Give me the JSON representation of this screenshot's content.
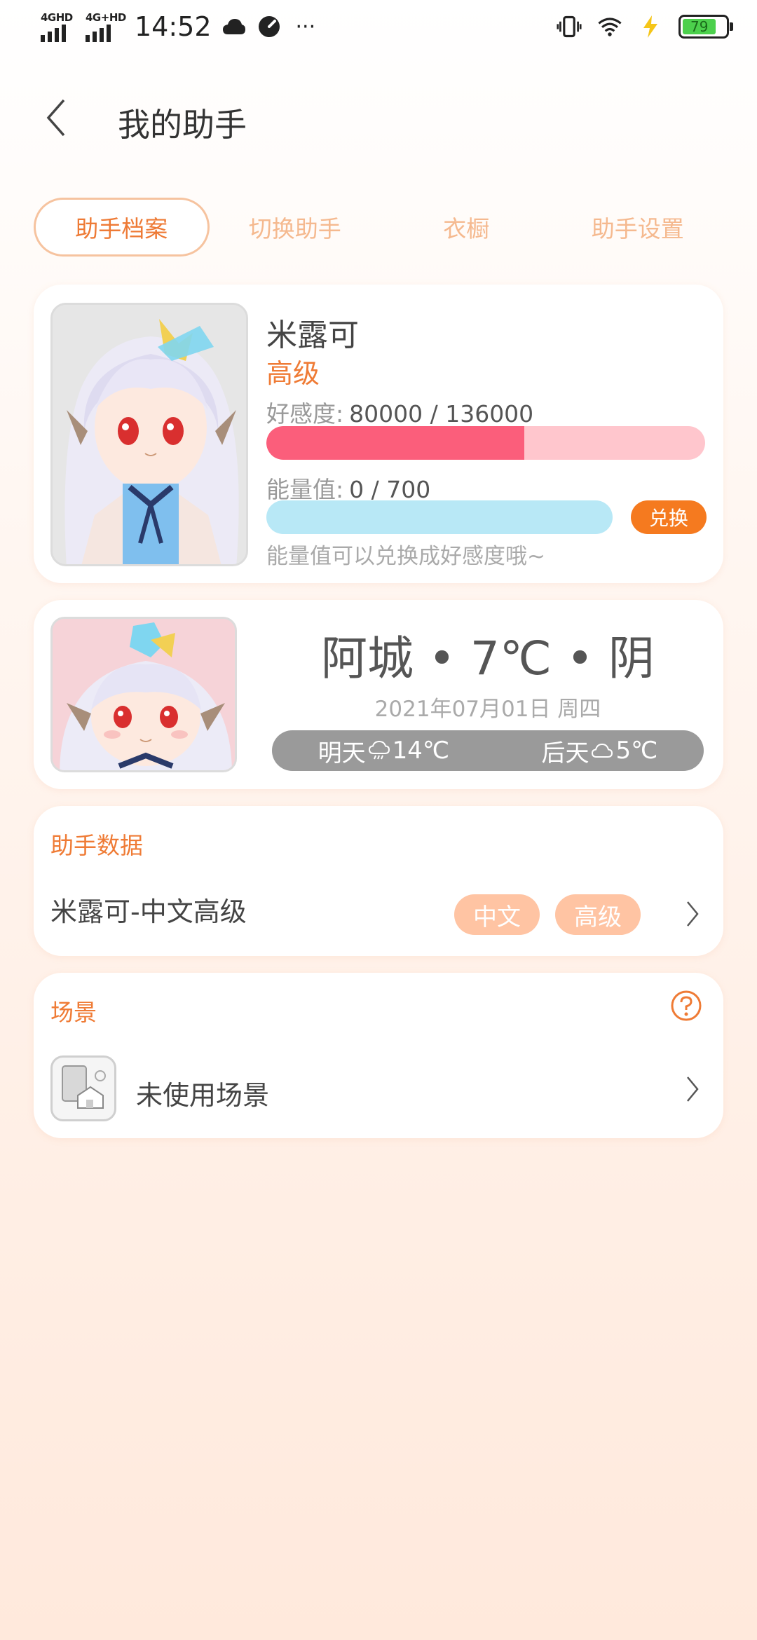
{
  "status_bar": {
    "sim1": "4GHD",
    "sim2": "4G+HD",
    "time": "14:52",
    "more": "···",
    "battery": "79"
  },
  "header": {
    "title": "我的助手"
  },
  "tabs": [
    {
      "label": "助手档案",
      "active": true
    },
    {
      "label": "切换助手",
      "active": false
    },
    {
      "label": "衣橱",
      "active": false
    },
    {
      "label": "助手设置",
      "active": false
    }
  ],
  "profile": {
    "name": "米露可",
    "level": "高级",
    "favor_label": "好感度:",
    "favor_value": "80000 / 136000",
    "favor_fraction": 0.588,
    "energy_label": "能量值:",
    "energy_value": "0 / 700",
    "energy_fraction": 0,
    "exchange_label": "兑换",
    "hint": "能量值可以兑换成好感度哦~"
  },
  "weather": {
    "headline": "阿城 • 7℃ • 阴",
    "date": "2021年07月01日 周四",
    "tomorrow_label": "明天",
    "tomorrow_temp": "14℃",
    "tomorrow_icon": "rain-cloud-icon",
    "after_label": "后天",
    "after_temp": "5℃",
    "after_icon": "cloud-icon"
  },
  "assistant_data": {
    "title": "助手数据",
    "item": "米露可-中文高级",
    "tag_language": "中文",
    "tag_level": "高级"
  },
  "scene": {
    "title": "场景",
    "item": "未使用场景"
  },
  "colors": {
    "accent": "#ef7b35",
    "favor_fill": "#fb5e7b",
    "favor_track": "#ffc6cd",
    "energy_track": "#b8e8f6",
    "tag_bg": "#ffc4a3"
  }
}
